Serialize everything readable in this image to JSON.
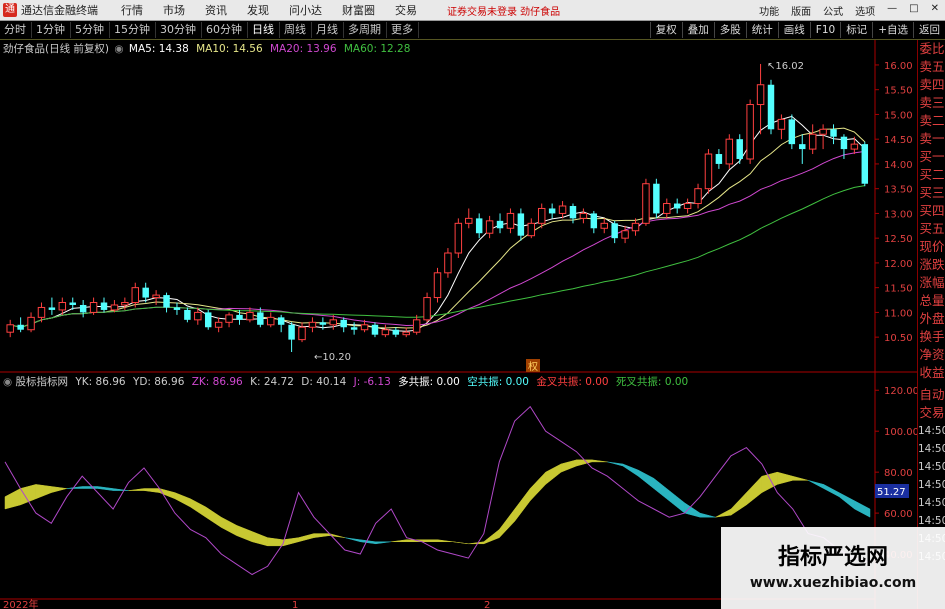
{
  "menubar": {
    "app_title": "通达信金融终端",
    "items": [
      "行情",
      "市场",
      "资讯",
      "发现",
      "问小达",
      "财富圈",
      "交易"
    ],
    "trade_notice": "证券交易未登录  劲仔食品",
    "right": [
      "功能",
      "版面",
      "公式",
      "选项"
    ]
  },
  "periodbar": {
    "items": [
      "分时",
      "1分钟",
      "5分钟",
      "15分钟",
      "30分钟",
      "60分钟",
      "日线",
      "周线",
      "月线",
      "多周期",
      "更多"
    ],
    "active": "日线",
    "right": [
      "复权",
      "叠加",
      "多股",
      "统计",
      "画线",
      "F10",
      "标记",
      "+自选",
      "返回"
    ]
  },
  "main_title": {
    "stock": "劲仔食品(日线 前复权)",
    "ma5": "MA5: 14.38",
    "ma10": "MA10: 14.56",
    "ma20": "MA20: 13.96",
    "ma60": "MA60: 12.28"
  },
  "indicator_title": {
    "name": "股标指标网",
    "yk": "YK: 86.96",
    "yd": "YD: 86.96",
    "zk": "ZK: 86.96",
    "k": "K: 24.72",
    "d": "D: 40.14",
    "j": "J: -6.13",
    "duo": "多共振: 0.00",
    "kong": "空共振: 0.00",
    "jincha": "金叉共振: 0.00",
    "sicha": "死叉共振: 0.00"
  },
  "annotations": {
    "high": "16.02",
    "low": "10.20",
    "quan": "权"
  },
  "price_axis": [
    "16.00",
    "15.50",
    "15.00",
    "14.50",
    "14.00",
    "13.50",
    "13.00",
    "12.50",
    "12.00",
    "11.50",
    "11.00",
    "10.50"
  ],
  "ind_axis": [
    "120.00",
    "100.00",
    "80.00",
    "60.00",
    "40.00"
  ],
  "ind_current": "51.27",
  "date_labels": [
    "2022年",
    "1",
    "2"
  ],
  "sidebar": {
    "items": [
      "委比",
      "卖五",
      "卖四",
      "卖三",
      "卖二",
      "卖一",
      "买一",
      "买二",
      "买三",
      "买四",
      "买五",
      "现价",
      "涨跌",
      "涨幅",
      "总量",
      "外盘",
      "换手",
      "净资",
      "收益"
    ],
    "lower": [
      "自动",
      "交易",
      "14:50",
      "14:50",
      "14:50",
      "14:50",
      "14:50",
      "14:50",
      "14:50",
      "14:50"
    ]
  },
  "watermark": {
    "title": "指标严选网",
    "url": "www.xuezhibiao.com"
  },
  "colors": {
    "up": "#ff4040",
    "down": "#54ffff",
    "ma5": "#ffffff",
    "ma10": "#e6e68a",
    "ma20": "#d048d0",
    "ma60": "#40c040"
  },
  "chart_data": {
    "type": "candlestick",
    "ylim": [
      10.2,
      16.1
    ],
    "candles": [
      [
        10.6,
        10.75,
        10.5,
        10.85
      ],
      [
        10.75,
        10.65,
        10.6,
        10.9
      ],
      [
        10.65,
        10.9,
        10.6,
        11.0
      ],
      [
        10.9,
        11.1,
        10.8,
        11.2
      ],
      [
        11.1,
        11.05,
        10.95,
        11.3
      ],
      [
        11.05,
        11.2,
        10.95,
        11.3
      ],
      [
        11.2,
        11.15,
        11.05,
        11.3
      ],
      [
        11.15,
        11.0,
        10.9,
        11.25
      ],
      [
        11.0,
        11.2,
        10.95,
        11.3
      ],
      [
        11.2,
        11.05,
        11.0,
        11.3
      ],
      [
        11.05,
        11.15,
        11.0,
        11.25
      ],
      [
        11.15,
        11.2,
        11.05,
        11.3
      ],
      [
        11.2,
        11.5,
        11.1,
        11.6
      ],
      [
        11.5,
        11.3,
        11.2,
        11.6
      ],
      [
        11.3,
        11.35,
        11.15,
        11.45
      ],
      [
        11.35,
        11.1,
        11.0,
        11.4
      ],
      [
        11.1,
        11.05,
        10.95,
        11.2
      ],
      [
        11.05,
        10.85,
        10.8,
        11.1
      ],
      [
        10.85,
        11.0,
        10.75,
        11.1
      ],
      [
        11.0,
        10.7,
        10.65,
        11.05
      ],
      [
        10.7,
        10.8,
        10.6,
        10.9
      ],
      [
        10.8,
        10.95,
        10.7,
        11.0
      ],
      [
        10.95,
        10.85,
        10.75,
        11.05
      ],
      [
        10.85,
        11.0,
        10.8,
        11.1
      ],
      [
        11.0,
        10.75,
        10.7,
        11.1
      ],
      [
        10.75,
        10.9,
        10.7,
        11.0
      ],
      [
        10.9,
        10.75,
        10.6,
        10.95
      ],
      [
        10.75,
        10.45,
        10.2,
        10.8
      ],
      [
        10.45,
        10.7,
        10.4,
        10.8
      ],
      [
        10.7,
        10.8,
        10.6,
        10.9
      ],
      [
        10.8,
        10.75,
        10.65,
        10.9
      ],
      [
        10.75,
        10.85,
        10.65,
        10.95
      ],
      [
        10.85,
        10.7,
        10.6,
        10.9
      ],
      [
        10.7,
        10.65,
        10.55,
        10.8
      ],
      [
        10.65,
        10.75,
        10.6,
        10.85
      ],
      [
        10.75,
        10.55,
        10.5,
        10.8
      ],
      [
        10.55,
        10.65,
        10.5,
        10.75
      ],
      [
        10.65,
        10.55,
        10.5,
        10.7
      ],
      [
        10.55,
        10.6,
        10.5,
        10.7
      ],
      [
        10.6,
        10.85,
        10.55,
        10.95
      ],
      [
        10.85,
        11.3,
        10.8,
        11.4
      ],
      [
        11.3,
        11.8,
        11.2,
        11.9
      ],
      [
        11.8,
        12.2,
        11.7,
        12.3
      ],
      [
        12.2,
        12.8,
        12.1,
        12.9
      ],
      [
        12.8,
        12.9,
        12.7,
        13.1
      ],
      [
        12.9,
        12.6,
        12.5,
        13.0
      ],
      [
        12.6,
        12.85,
        12.5,
        12.95
      ],
      [
        12.85,
        12.7,
        12.6,
        13.0
      ],
      [
        12.7,
        13.0,
        12.6,
        13.1
      ],
      [
        13.0,
        12.55,
        12.45,
        13.1
      ],
      [
        12.55,
        12.8,
        12.5,
        12.9
      ],
      [
        12.8,
        13.1,
        12.7,
        13.2
      ],
      [
        13.1,
        13.0,
        12.9,
        13.2
      ],
      [
        13.0,
        13.15,
        12.9,
        13.25
      ],
      [
        13.15,
        12.9,
        12.8,
        13.2
      ],
      [
        12.9,
        13.0,
        12.8,
        13.1
      ],
      [
        13.0,
        12.7,
        12.6,
        13.05
      ],
      [
        12.7,
        12.8,
        12.6,
        12.9
      ],
      [
        12.8,
        12.5,
        12.4,
        12.85
      ],
      [
        12.5,
        12.65,
        12.4,
        12.75
      ],
      [
        12.65,
        12.8,
        12.55,
        12.9
      ],
      [
        12.8,
        13.6,
        12.75,
        13.7
      ],
      [
        13.6,
        13.0,
        12.9,
        13.7
      ],
      [
        13.0,
        13.2,
        12.9,
        13.3
      ],
      [
        13.2,
        13.1,
        13.0,
        13.3
      ],
      [
        13.1,
        13.2,
        13.0,
        13.3
      ],
      [
        13.2,
        13.5,
        13.1,
        13.6
      ],
      [
        13.5,
        14.2,
        13.4,
        14.3
      ],
      [
        14.2,
        14.0,
        13.9,
        14.3
      ],
      [
        14.0,
        14.5,
        13.9,
        14.6
      ],
      [
        14.5,
        14.1,
        14.0,
        14.6
      ],
      [
        14.1,
        15.2,
        14.0,
        15.3
      ],
      [
        15.2,
        15.6,
        14.6,
        16.02
      ],
      [
        15.6,
        14.7,
        14.6,
        15.7
      ],
      [
        14.7,
        14.9,
        14.5,
        15.0
      ],
      [
        14.9,
        14.4,
        14.3,
        15.0
      ],
      [
        14.4,
        14.3,
        14.0,
        14.6
      ],
      [
        14.3,
        14.6,
        14.2,
        14.8
      ],
      [
        14.6,
        14.7,
        14.3,
        14.8
      ],
      [
        14.7,
        14.55,
        14.4,
        14.8
      ],
      [
        14.55,
        14.3,
        14.1,
        14.6
      ],
      [
        14.3,
        14.4,
        14.2,
        14.55
      ],
      [
        14.4,
        13.6,
        13.55,
        14.45
      ]
    ]
  },
  "indicator_data": {
    "type": "line",
    "ylim": [
      20,
      125
    ],
    "k": [
      85,
      72,
      60,
      55,
      68,
      78,
      70,
      62,
      75,
      82,
      72,
      60,
      52,
      48,
      40,
      35,
      30,
      34,
      45,
      70,
      58,
      50,
      42,
      40,
      55,
      62,
      48,
      46,
      42,
      40,
      38,
      50,
      85,
      105,
      112,
      100,
      95,
      90,
      82,
      78,
      72,
      66,
      62,
      58,
      60,
      68,
      78,
      88,
      92,
      84,
      70,
      62,
      50,
      48,
      42,
      38,
      36
    ],
    "yk": [
      68,
      72,
      74,
      73,
      72,
      72,
      72,
      71,
      71,
      72,
      72,
      70,
      67,
      63,
      58,
      54,
      51,
      48,
      47,
      48,
      50,
      50,
      48,
      46,
      45,
      46,
      47,
      47,
      47,
      46,
      45,
      46,
      52,
      62,
      72,
      80,
      84,
      86,
      86,
      85,
      83,
      78,
      72,
      66,
      60,
      58,
      58,
      62,
      70,
      78,
      80,
      78,
      76,
      72,
      68,
      62,
      58
    ],
    "zk": [
      62,
      64,
      67,
      70,
      72,
      73,
      73,
      72,
      71,
      71,
      70,
      67,
      63,
      58,
      53,
      49,
      46,
      44,
      44,
      46,
      48,
      49,
      48,
      47,
      46,
      46,
      46,
      46,
      46,
      46,
      45,
      45,
      48,
      56,
      66,
      74,
      80,
      83,
      85,
      85,
      84,
      81,
      77,
      71,
      65,
      60,
      58,
      59,
      64,
      70,
      74,
      76,
      76,
      74,
      70,
      66,
      62
    ]
  }
}
